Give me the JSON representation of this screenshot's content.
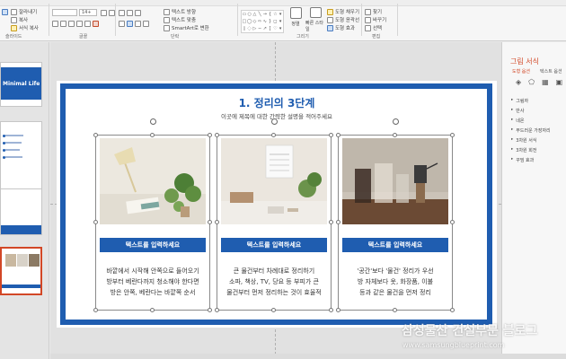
{
  "ribbon": {
    "paste_label": "붙여넣기",
    "cut_label": "잘라내기",
    "copy_label": "복사",
    "format_label": "서식 복사",
    "font_size": "14+",
    "groups": [
      "슬라이드",
      "글꼴",
      "단락",
      "그리기",
      "편집"
    ],
    "convert_smartart": "SmartArt로 변환",
    "text_direction": "텍스트 방향",
    "text_align": "텍스트 맞춤",
    "quick_styles_label": "빠른 스타일",
    "arrange_label": "정렬",
    "shape_fill": "도형 채우기",
    "shape_outline": "도형 윤곽선",
    "shape_effects": "도형 효과",
    "find_label": "찾기",
    "replace_label": "바꾸기",
    "select_label": "선택"
  },
  "thumbnails": {
    "slide1_title": "Minimal Life"
  },
  "slide": {
    "title": "1. 정리의 3단계",
    "subtitle": "이곳에 제목에 대한 간략한 설명을 적어주세요",
    "cards": [
      {
        "banner": "텍스트를 입력하세요",
        "lines": [
          "바깥에서 시작해 안쪽으로 들어오기",
          "방부터 베란다까지 청소해야 한다면",
          "방은 안쪽, 베란다는 바깥쪽 순서"
        ]
      },
      {
        "banner": "텍스트를 입력하세요",
        "lines": [
          "큰 물건부터 차례대로 정리하기",
          "소파, 책상, TV, 당요 등 부피가 큰",
          "물건부터 먼저 정리하는 것이 효율적"
        ]
      },
      {
        "banner": "텍스트를 입력하세요",
        "lines": [
          "'공간'보다 '물건' 정리가 우선",
          "방 자체보다 옷, 화장품, 이불",
          "등과 같은 물건을 먼저 정리"
        ]
      }
    ]
  },
  "pane": {
    "title": "그림 서식",
    "tab_shape": "도형 옵션",
    "tab_text": "텍스트 옵션",
    "sections": [
      "그림자",
      "반사",
      "네온",
      "부드러운 가장자리",
      "3차원 서식",
      "3차원 회전",
      "꾸밈 효과"
    ]
  },
  "watermark": {
    "line1": "삼성물산 건설부문 블로그",
    "line2": "www.samsungblueprint.com"
  },
  "colors": {
    "accent_blue": "#1f5db0",
    "accent_red": "#d24726"
  }
}
